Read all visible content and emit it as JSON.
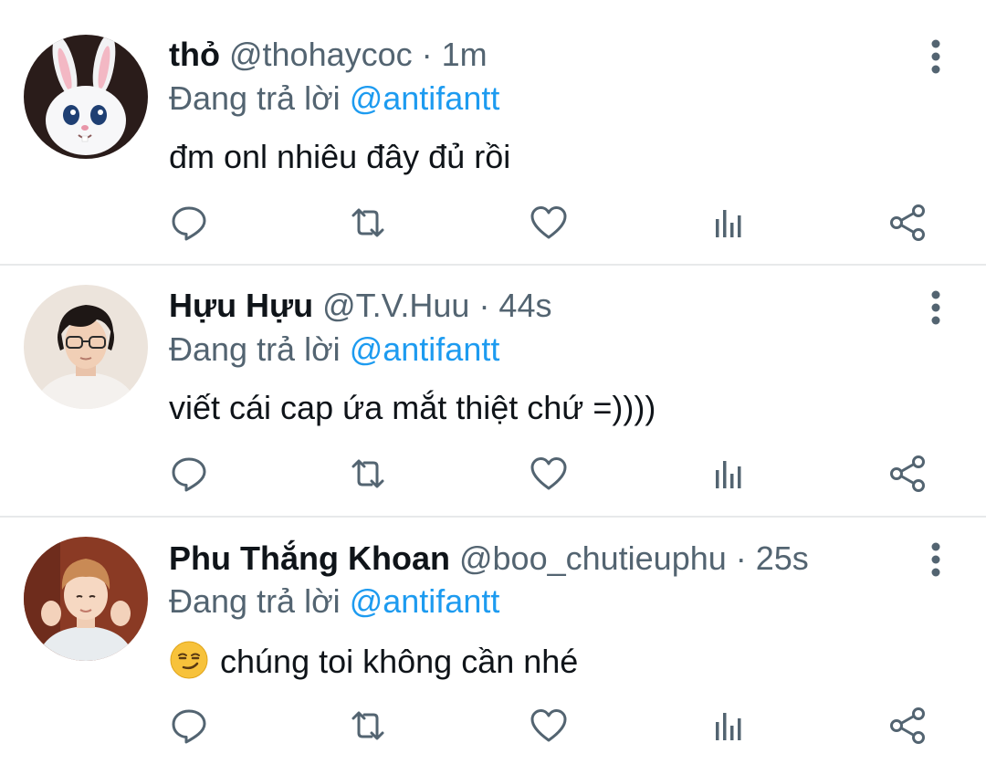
{
  "colors": {
    "text_primary": "#0f1419",
    "text_secondary": "#536471",
    "mention": "#1d9bf0",
    "divider": "#e7e9ea"
  },
  "reply_prefix": "Đang trả lời",
  "tweets": [
    {
      "display_name": "thỏ",
      "meta": "@thohaycoc · 1m",
      "reply_to": "@antifantt",
      "text": "đm onl nhiêu đây đủ rồi",
      "avatar": "white-bunny-avatar"
    },
    {
      "display_name": "Hựu Hựu",
      "meta": "@T.V.Huu · 44s",
      "reply_to": "@antifantt",
      "text": "viết cái cap ứa mắt thiệt chứ =))))",
      "avatar": "person-with-glasses-avatar"
    },
    {
      "display_name": "Phu Thắng Khoan",
      "meta": "@boo_chutieuphu · 25s",
      "reply_to": "@antifantt",
      "text": "chúng toi không cần nhé",
      "emoji": "smirking-face-emoji",
      "avatar": "person-posing-avatar"
    }
  ],
  "action_icons": [
    "reply-icon",
    "retweet-icon",
    "like-icon",
    "analytics-icon",
    "share-icon"
  ]
}
